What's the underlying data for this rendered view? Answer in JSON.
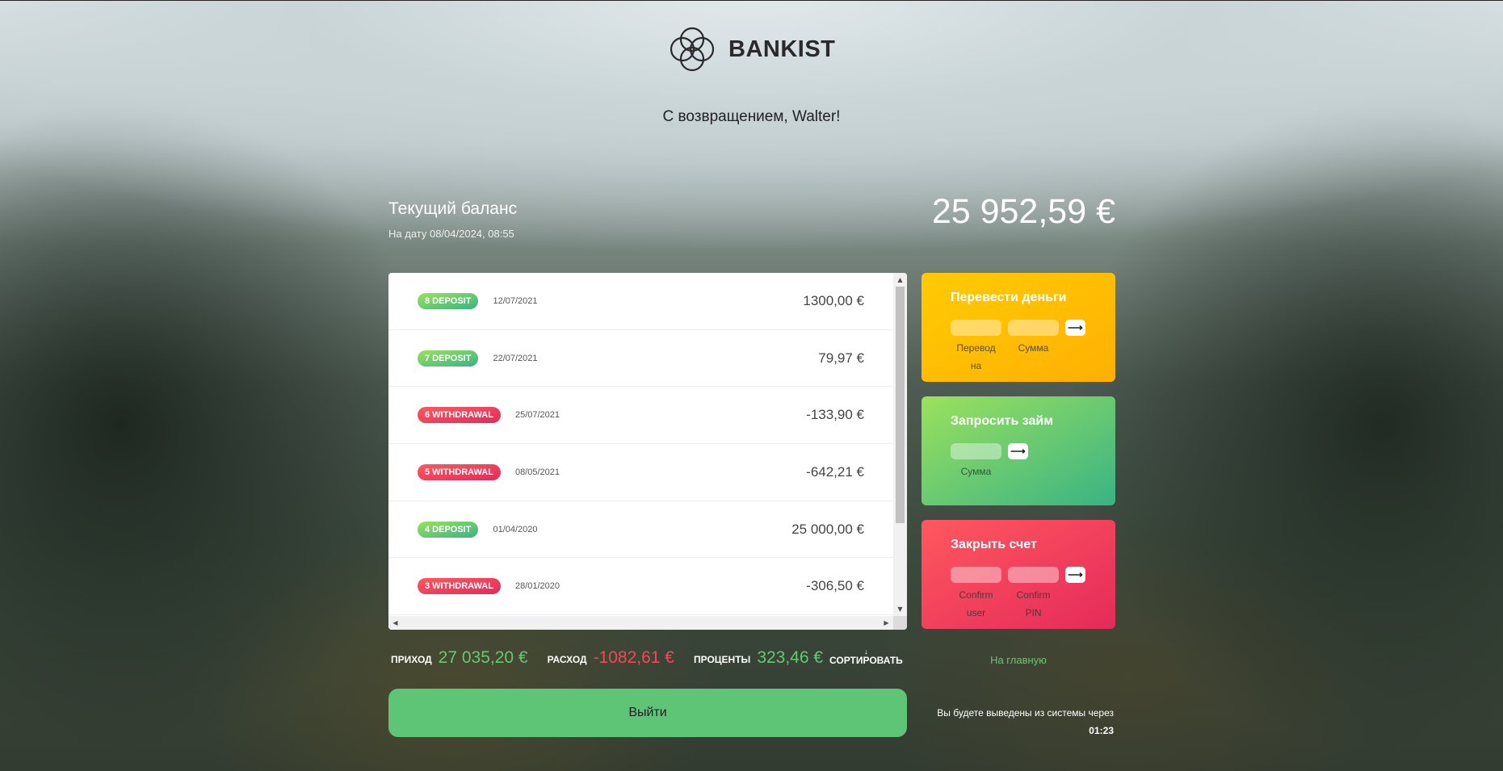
{
  "header": {
    "logo_text": "BANKIST",
    "welcome": "С возвращением, Walter!"
  },
  "balance": {
    "label": "Текущий баланс",
    "date": "На дату 08/04/2024, 08:55",
    "value": "25 952,59 €"
  },
  "movements": [
    {
      "type": "8 DEPOSIT",
      "kind": "deposit",
      "date": "12/07/2021",
      "value": "1300,00 €"
    },
    {
      "type": "7 DEPOSIT",
      "kind": "deposit",
      "date": "22/07/2021",
      "value": "79,97 €"
    },
    {
      "type": "6 WITHDRAWAL",
      "kind": "withdrawal",
      "date": "25/07/2021",
      "value": "-133,90 €"
    },
    {
      "type": "5 WITHDRAWAL",
      "kind": "withdrawal",
      "date": "08/05/2021",
      "value": "-642,21 €"
    },
    {
      "type": "4 DEPOSIT",
      "kind": "deposit",
      "date": "01/04/2020",
      "value": "25 000,00 €"
    },
    {
      "type": "3 WITHDRAWAL",
      "kind": "withdrawal",
      "date": "28/01/2020",
      "value": "-306,50 €"
    }
  ],
  "operations": {
    "transfer": {
      "title": "Перевести деньги",
      "to_label": "Перевод на",
      "amount_label": "Сумма"
    },
    "loan": {
      "title": "Запросить займ",
      "amount_label": "Сумма"
    },
    "close": {
      "title": "Закрыть счет",
      "user_label": "Confirm user",
      "pin_label": "Confirm PIN"
    }
  },
  "summary": {
    "in_label": "Приход",
    "in_value": "27 035,20 €",
    "out_label": "Расход",
    "out_value": "-1082,61 €",
    "interest_label": "Проценты",
    "interest_value": "323,46 €",
    "sort_arrow": "↓",
    "sort_label": "Сортировать"
  },
  "links": {
    "home": "На главную"
  },
  "logout": {
    "button": "Выйти",
    "timer_text": "Вы будете выведены из системы через",
    "timer_value": "01:23"
  },
  "colors": {
    "deposit": "#39b385",
    "withdrawal": "#e52a5a",
    "transfer": "#ffb003",
    "loan": "#39b385",
    "close": "#e52a5a",
    "logout": "#5ec576"
  }
}
